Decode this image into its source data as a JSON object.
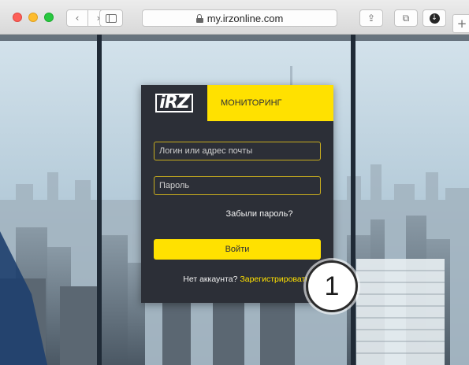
{
  "browser": {
    "url": "my.irzonline.com",
    "back_icon": "chevron-left-icon",
    "forward_icon": "chevron-right-icon",
    "back_glyph": "‹",
    "forward_glyph": "›",
    "share_glyph": "⇪",
    "tabs_glyph": "⧉",
    "download_glyph": "↓",
    "newtab_glyph": "+"
  },
  "login": {
    "logo": "iRZ",
    "title": "МОНИТОРИНГ",
    "login_placeholder": "Логин или адрес почты",
    "password_placeholder": "Пароль",
    "forgot_link": "Забыли пароль?",
    "submit_label": "Войти",
    "no_account_text": "Нет аккаунта?",
    "register_link": "Зарегистрироваться"
  },
  "callout": {
    "number": "1"
  },
  "colors": {
    "accent": "#ffe100",
    "card": "#2c2f37"
  }
}
